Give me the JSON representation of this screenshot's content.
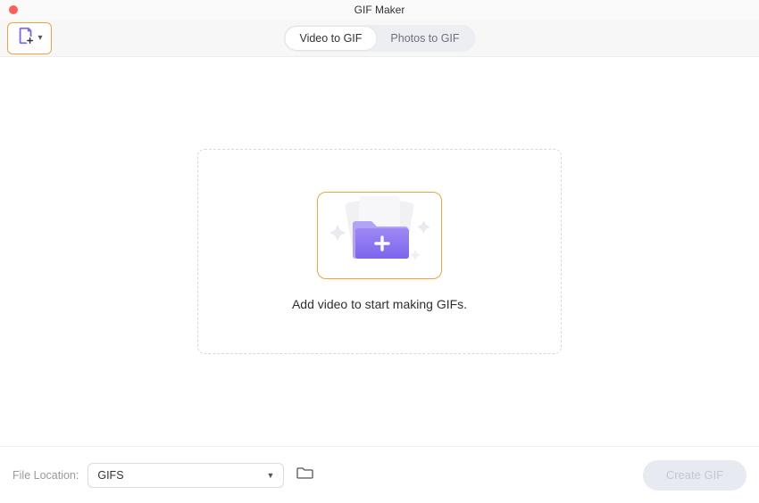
{
  "window": {
    "title": "GIF Maker"
  },
  "tabs": {
    "video": "Video to GIF",
    "photos": "Photos to GIF",
    "active": "video"
  },
  "dropzone": {
    "prompt": "Add video to start making GIFs."
  },
  "footer": {
    "location_label": "File Location:",
    "location_value": "GIFS",
    "create_label": "Create GIF"
  },
  "icons": {
    "add_file": "add-file-icon",
    "chevron_down": "chevron-down-icon",
    "folder_open": "folder-open-icon",
    "folder_add": "folder-add-icon"
  },
  "colors": {
    "accent_orange": "#f2a33a",
    "folder_purple": "#8b74f0",
    "folder_purple_light": "#b3a3f6"
  }
}
